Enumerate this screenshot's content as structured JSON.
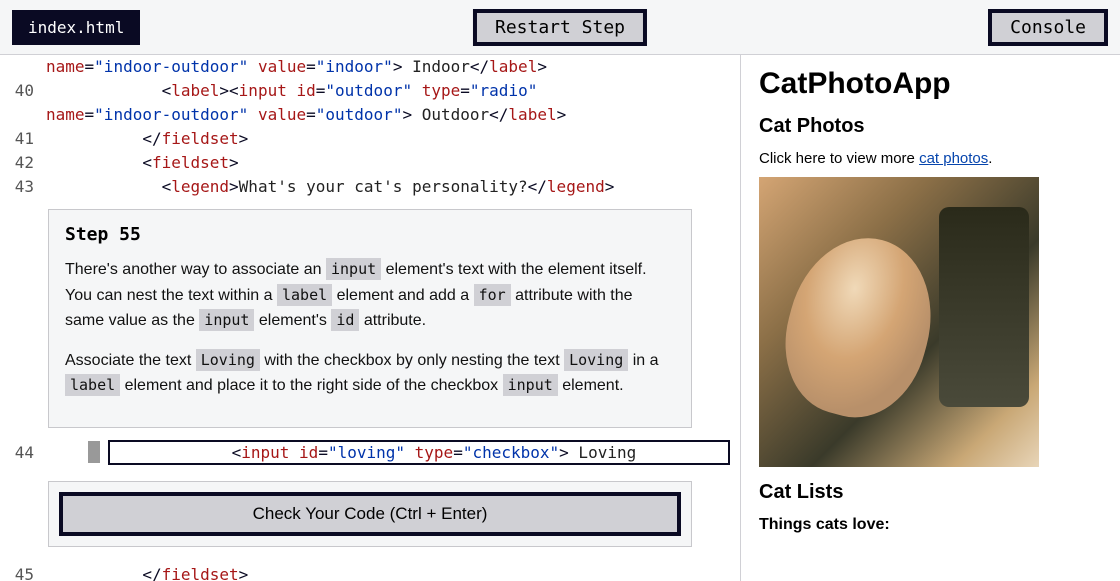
{
  "topbar": {
    "file_tab": "index.html",
    "restart_label": "Restart Step",
    "console_label": "Console"
  },
  "code": {
    "lines": [
      {
        "num": "",
        "html": "<span class='attr-name'>name</span><span class='punct'>=</span><span class='attr-val'>\"indoor-outdoor\"</span> <span class='attr-name'>value</span><span class='punct'>=</span><span class='attr-val'>\"indoor\"</span><span class='punct'>&gt;</span><span class='text'> Indoor</span><span class='punct'>&lt;/</span><span class='elem'>label</span><span class='punct'>&gt;</span>"
      },
      {
        "num": "40",
        "html": "            <span class='punct'>&lt;</span><span class='elem'>label</span><span class='punct'>&gt;&lt;</span><span class='elem'>input</span> <span class='attr-name'>id</span><span class='punct'>=</span><span class='attr-val'>\"outdoor\"</span> <span class='attr-name'>type</span><span class='punct'>=</span><span class='attr-val'>\"radio\"</span>"
      },
      {
        "num": "",
        "html": "<span class='attr-name'>name</span><span class='punct'>=</span><span class='attr-val'>\"indoor-outdoor\"</span> <span class='attr-name'>value</span><span class='punct'>=</span><span class='attr-val'>\"outdoor\"</span><span class='punct'>&gt;</span><span class='text'> Outdoor</span><span class='punct'>&lt;/</span><span class='elem'>label</span><span class='punct'>&gt;</span>"
      },
      {
        "num": "41",
        "html": "          <span class='punct'>&lt;/</span><span class='elem'>fieldset</span><span class='punct'>&gt;</span>"
      },
      {
        "num": "42",
        "html": "          <span class='punct'>&lt;</span><span class='elem'>fieldset</span><span class='punct'>&gt;</span>"
      },
      {
        "num": "43",
        "html": "            <span class='punct'>&lt;</span><span class='elem'>legend</span><span class='punct'>&gt;</span><span class='text'>What's your cat's personality?</span><span class='punct'>&lt;/</span><span class='elem'>legend</span><span class='punct'>&gt;</span>"
      }
    ],
    "editable": {
      "num": "44",
      "html": "            <span class='punct'>&lt;</span><span class='elem'>input</span> <span class='attr-name'>id</span><span class='punct'>=</span><span class='attr-val'>\"loving\"</span> <span class='attr-name'>type</span><span class='punct'>=</span><span class='attr-val'>\"checkbox\"</span><span class='punct'>&gt;</span><span class='text'> Loving</span>"
    },
    "after": [
      {
        "num": "45",
        "html": "          <span class='punct'>&lt;/</span><span class='elem'>fieldset</span><span class='punct'>&gt;</span>"
      }
    ]
  },
  "step": {
    "title": "Step 55",
    "p1_parts": [
      "There's another way to associate an ",
      "input",
      " element's text with the element itself. You can nest the text within a ",
      "label",
      " element and add a ",
      "for",
      " attribute with the same value as the ",
      "input",
      " element's ",
      "id",
      " attribute."
    ],
    "p2_parts": [
      "Associate the text ",
      "Loving",
      " with the checkbox by only nesting the text ",
      "Loving",
      " in a ",
      "label",
      " element and place it to the right side of the checkbox ",
      "input",
      " element."
    ]
  },
  "check_button": "Check Your Code (Ctrl + Enter)",
  "preview": {
    "h1": "CatPhotoApp",
    "h2a": "Cat Photos",
    "p_text": "Click here to view more ",
    "link": "cat photos",
    "period": ".",
    "h2b": "Cat Lists",
    "h3": "Things cats love:"
  }
}
